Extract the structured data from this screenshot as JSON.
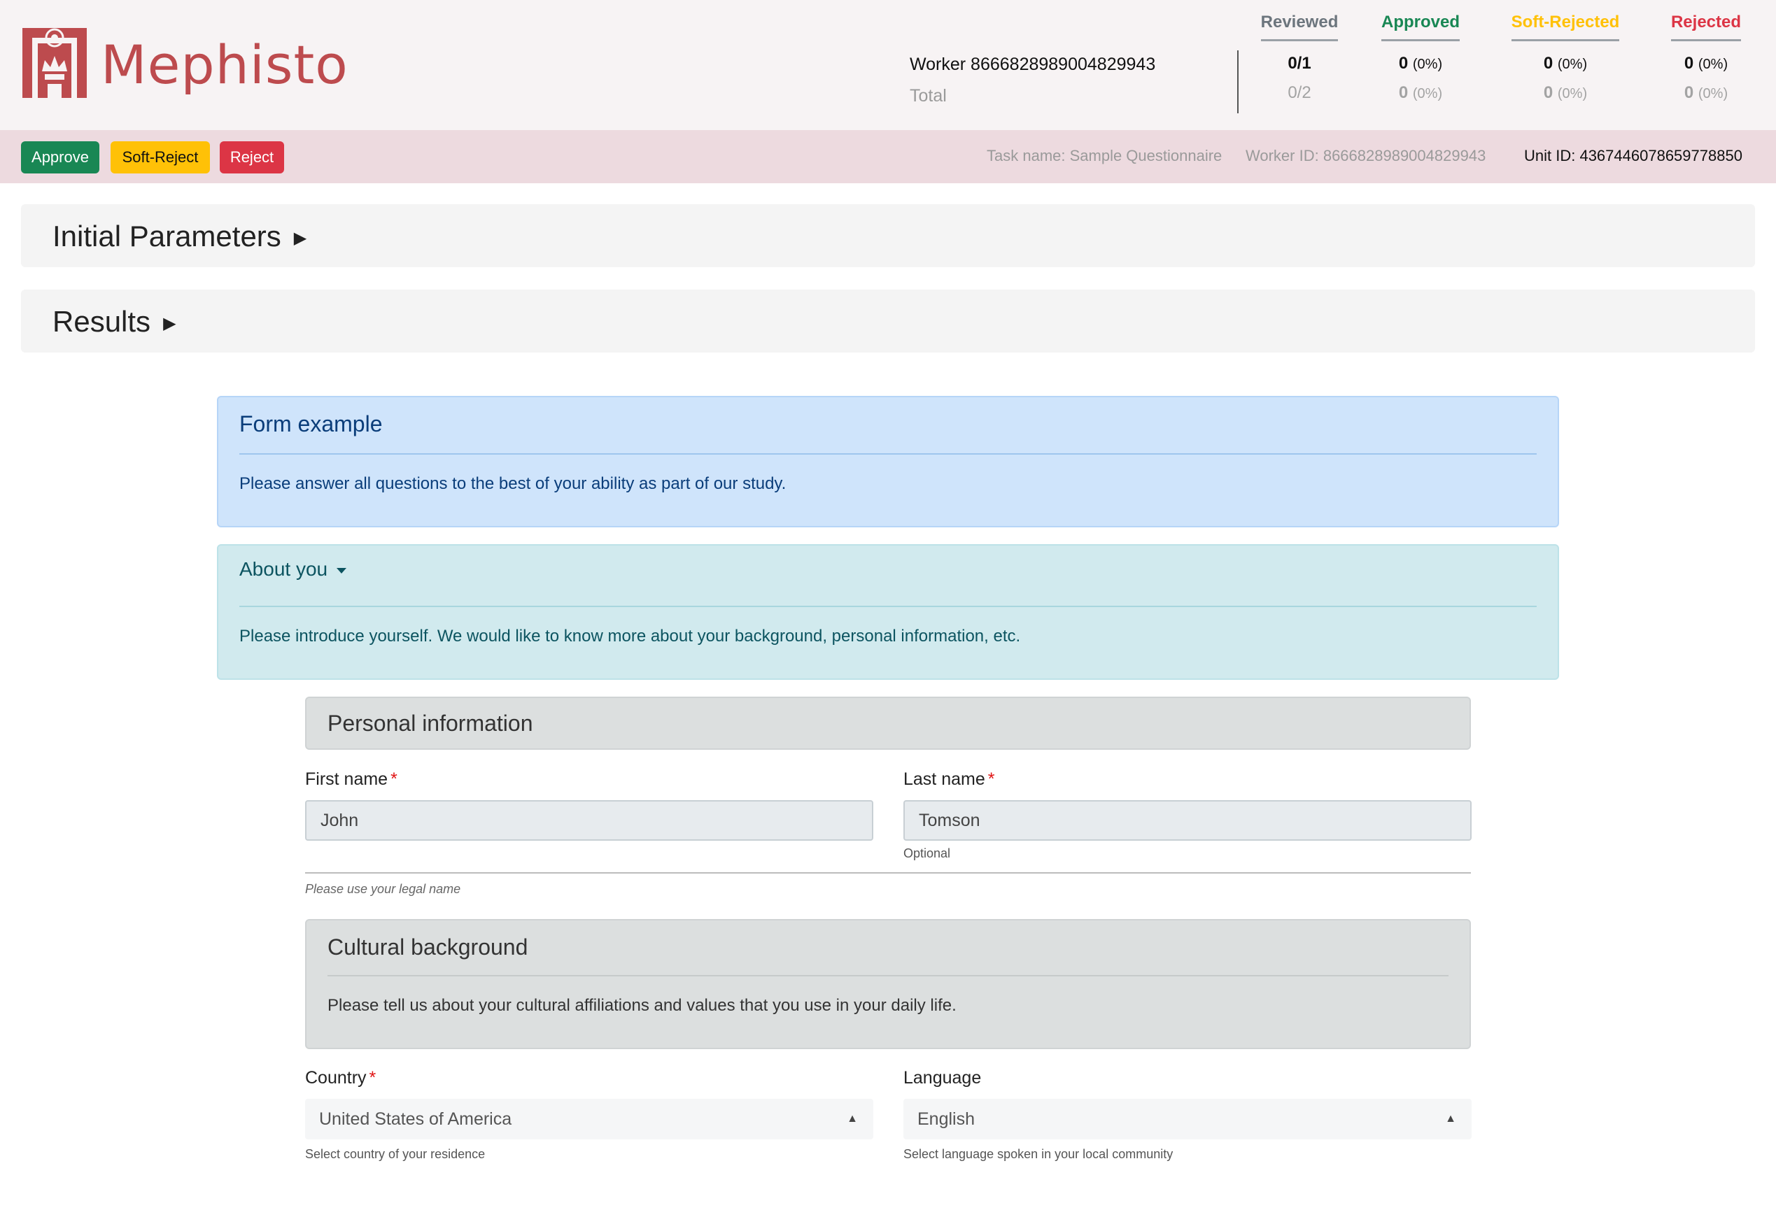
{
  "header": {
    "brand": "Mephisto",
    "worker_label": "Worker 8666828989004829943",
    "total_label": "Total",
    "stats": {
      "reviewed": {
        "title": "Reviewed",
        "worker": "0/1",
        "total": "0/2"
      },
      "approved": {
        "title": "Approved",
        "worker_count": "0",
        "worker_pct": "(0%)",
        "total_count": "0",
        "total_pct": "(0%)"
      },
      "soft_rejected": {
        "title": "Soft-Rejected",
        "worker_count": "0",
        "worker_pct": "(0%)",
        "total_count": "0",
        "total_pct": "(0%)"
      },
      "rejected": {
        "title": "Rejected",
        "worker_count": "0",
        "worker_pct": "(0%)",
        "total_count": "0",
        "total_pct": "(0%)"
      }
    }
  },
  "actions": {
    "approve": "Approve",
    "soft_reject": "Soft-Reject",
    "reject": "Reject",
    "task_name": "Task name: Sample Questionnaire",
    "worker_id": "Worker ID: 8666828989004829943",
    "unit_id": "Unit ID: 4367446078659778850"
  },
  "panels": {
    "initial_parameters": "Initial Parameters",
    "results": "Results",
    "arrow": "▶"
  },
  "form": {
    "title": "Form example",
    "instructions": "Please answer all questions to the best of your ability as part of our study.",
    "about": {
      "title": "About you",
      "text": "Please introduce yourself. We would like to know more about your background, personal information, etc."
    },
    "personal": {
      "title": "Personal information",
      "first_name_label": "First name",
      "first_name_value": "John",
      "last_name_label": "Last name",
      "last_name_value": "Tomson",
      "last_name_hint": "Optional",
      "section_hint": "Please use your legal name"
    },
    "cultural": {
      "title": "Cultural background",
      "text": "Please tell us about your cultural affiliations and values that you use in your daily life.",
      "country_label": "Country",
      "country_value": "United States of America",
      "country_hint": "Select country of your residence",
      "language_label": "Language",
      "language_value": "English",
      "language_hint": "Select language spoken in your local community"
    },
    "required_mark": "*"
  },
  "colors": {
    "brand": "#bd4b4e",
    "approve": "#198754",
    "soft_reject": "#ffc107",
    "reject": "#dc3545"
  },
  "icons": [
    "mephisto-logo-icon",
    "triangle-right-icon",
    "caret-down-icon",
    "caret-up-icon"
  ]
}
